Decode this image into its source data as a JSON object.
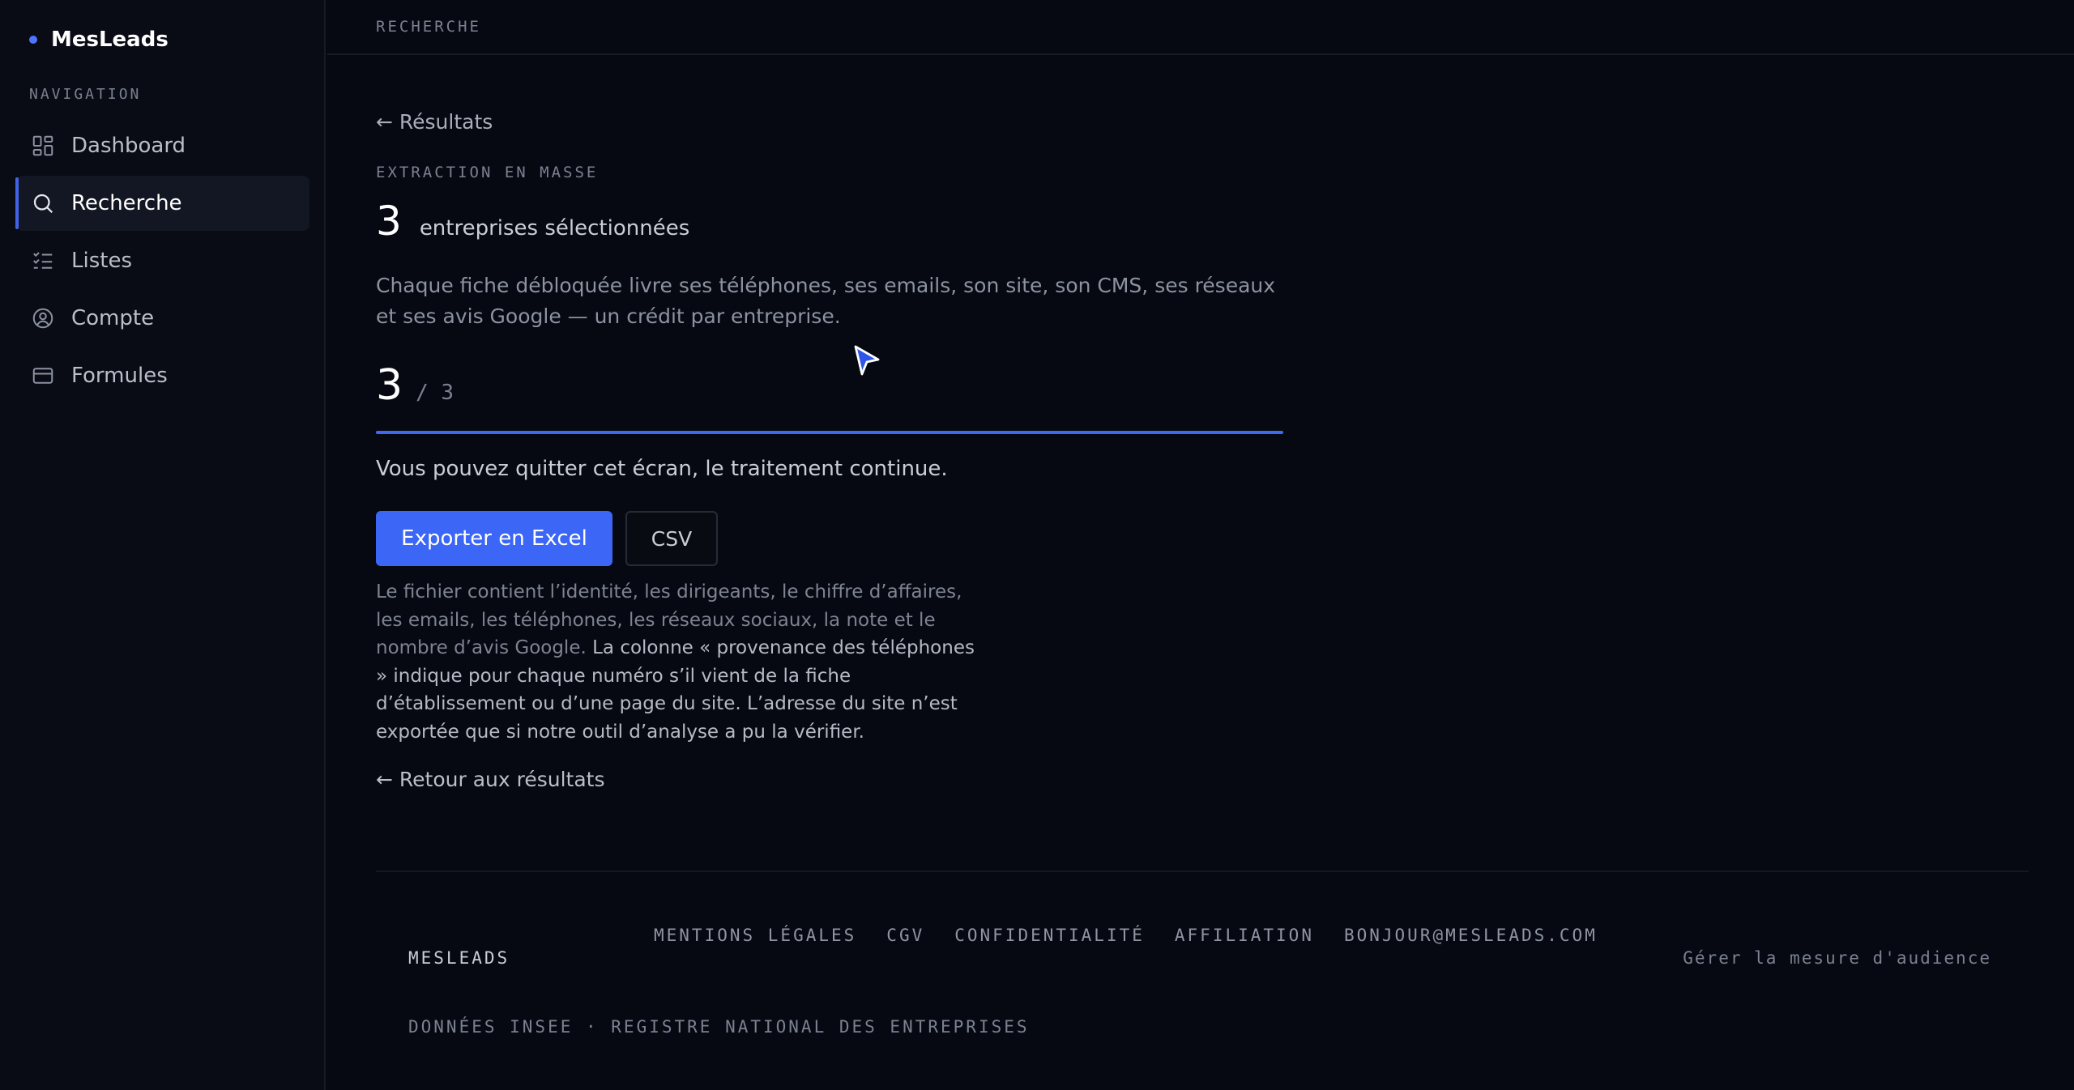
{
  "sidebar": {
    "brand": "MesLeads",
    "nav_heading": "NAVIGATION",
    "items": [
      {
        "label": "Dashboard",
        "icon": "dashboard-icon",
        "active": false
      },
      {
        "label": "Recherche",
        "icon": "search-icon",
        "active": true
      },
      {
        "label": "Listes",
        "icon": "list-check-icon",
        "active": false
      },
      {
        "label": "Compte",
        "icon": "user-circle-icon",
        "active": false
      },
      {
        "label": "Formules",
        "icon": "credit-card-icon",
        "active": false
      }
    ]
  },
  "topbar": {
    "title": "RECHERCHE"
  },
  "main": {
    "back_label": "← Résultats",
    "eyebrow": "EXTRACTION EN MASSE",
    "selected_count": "3",
    "selected_label": "entreprises sélectionnées",
    "description": "Chaque fiche débloquée livre ses téléphones, ses emails, son site, son CMS, ses réseaux et ses avis Google — un crédit par entreprise.",
    "progress": {
      "done": "3",
      "total": "/ 3",
      "fraction": 1.0
    },
    "notice": "Vous pouvez quitter cet écran, le traitement continue.",
    "export_excel_label": "Exporter en Excel",
    "export_csv_label": "CSV",
    "file_note_part1": "Le fichier contient l’identité, les dirigeants, le chiffre d’affaires, les emails, les téléphones, les réseaux sociaux, la note et le nombre d’avis Google.",
    "file_note_part2": "La colonne « provenance des téléphones » indique pour chaque numéro s’il vient de la fiche d’établissement ou d’une page du site. L’adresse du site n’est exportée que si notre outil d’analyse a pu la vérifier.",
    "back_results_label": "← Retour aux résultats"
  },
  "footer": {
    "brand": "MESLEADS",
    "links": [
      "MENTIONS LÉGALES",
      "CGV",
      "CONFIDENTIALITÉ",
      "AFFILIATION",
      "BONJOUR@MESLEADS.COM"
    ],
    "audience_label": "Gérer la mesure d'audience",
    "source": "DONNÉES INSEE · REGISTRE NATIONAL DES ENTREPRISES"
  },
  "colors": {
    "accent": "#3b66f6",
    "background": "#060912",
    "sidebar": "#090c15"
  }
}
